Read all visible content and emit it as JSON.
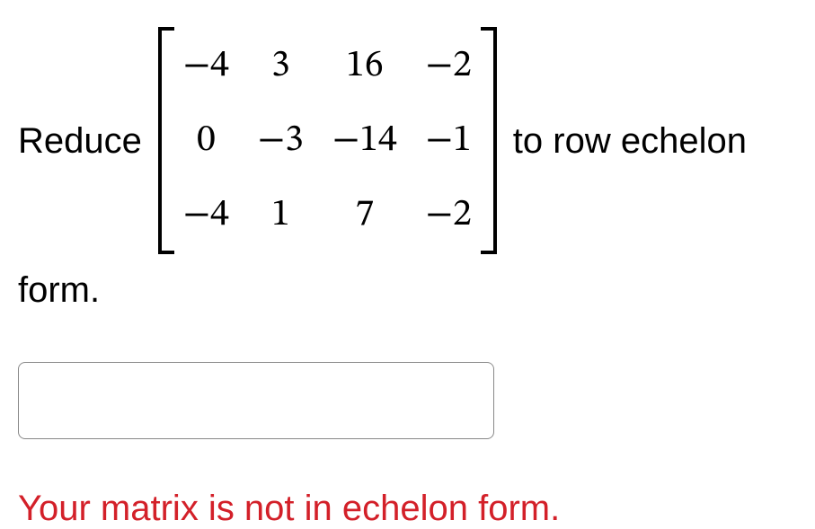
{
  "problem": {
    "text_before": "Reduce",
    "text_after": "to row echelon",
    "text_trailing": "form.",
    "matrix": {
      "rows": 3,
      "cols": 4,
      "cells": [
        "−4",
        "3",
        "16",
        "−2",
        "0",
        "−3",
        "−14",
        "−1",
        "−4",
        "1",
        "7",
        "−2"
      ]
    }
  },
  "input": {
    "value": ""
  },
  "feedback": {
    "message": "Your matrix is not in echelon form."
  },
  "chart_data": {
    "type": "table",
    "title": "Input matrix for row echelon reduction",
    "rows": 3,
    "cols": 4,
    "values": [
      [
        -4,
        3,
        16,
        -2
      ],
      [
        0,
        -3,
        -14,
        -1
      ],
      [
        -4,
        1,
        7,
        -2
      ]
    ]
  }
}
